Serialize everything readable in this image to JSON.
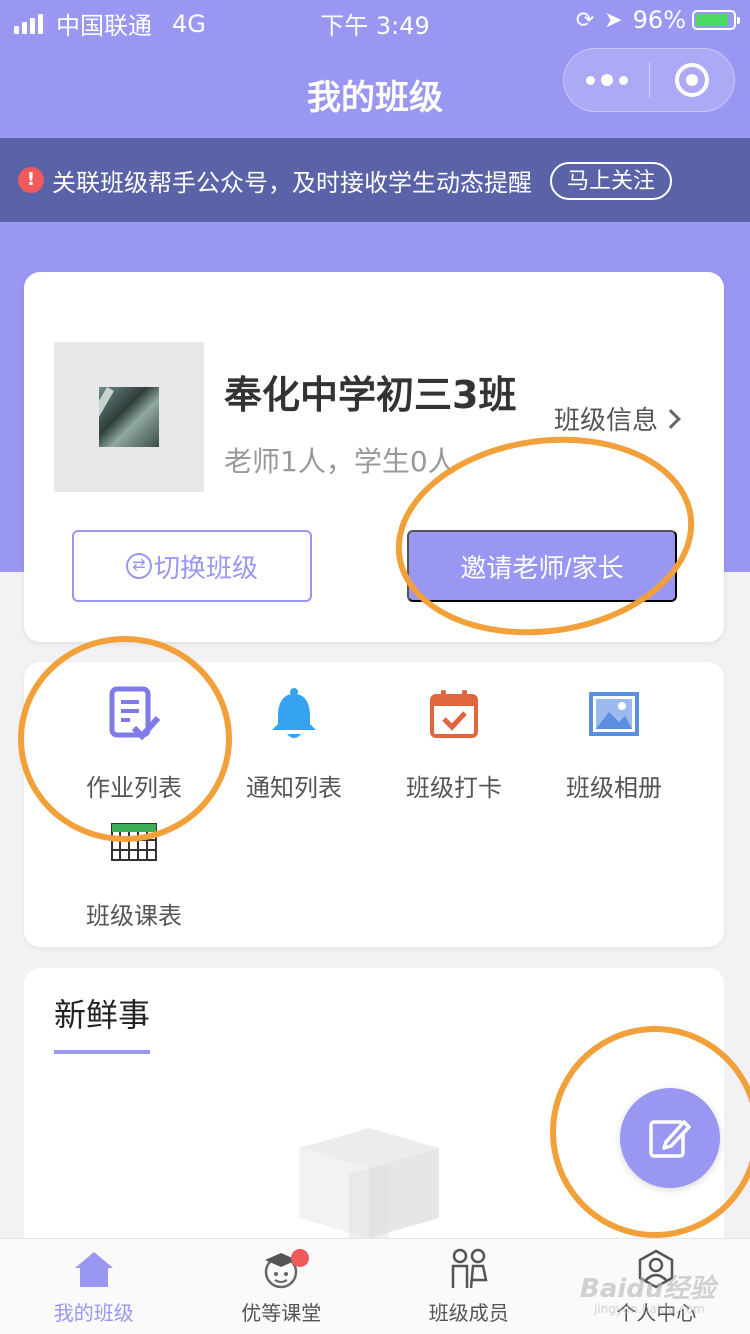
{
  "status_bar": {
    "carrier": "中国联通",
    "network": "4G",
    "time": "下午 3:49",
    "battery": "96%"
  },
  "nav": {
    "title": "我的班级"
  },
  "notice": {
    "text": "关联班级帮手公众号，及时接收学生动态提醒",
    "follow_label": "马上关注"
  },
  "class_card": {
    "name": "奉化中学初三3班",
    "stats": "老师1人，学生0人",
    "info_link": "班级信息",
    "switch_label": "切换班级",
    "invite_label": "邀请老师/家长"
  },
  "functions": [
    {
      "label": "作业列表",
      "icon": "homework-icon"
    },
    {
      "label": "通知列表",
      "icon": "bell-icon"
    },
    {
      "label": "班级打卡",
      "icon": "calendar-check-icon"
    },
    {
      "label": "班级相册",
      "icon": "photo-album-icon"
    },
    {
      "label": "班级课表",
      "icon": "timetable-icon"
    }
  ],
  "news": {
    "title": "新鲜事"
  },
  "tabs": [
    {
      "label": "我的班级",
      "icon": "house-icon",
      "active": true
    },
    {
      "label": "优等课堂",
      "icon": "graduation-icon",
      "badge": true
    },
    {
      "label": "班级成员",
      "icon": "members-icon"
    },
    {
      "label": "个人中心",
      "icon": "user-icon"
    }
  ],
  "watermark": {
    "text": "Baidu经验",
    "sub": "jingyan.baidu.com"
  },
  "colors": {
    "primary": "#9a97f3",
    "notice_bg": "#5a63a8",
    "annotation": "#f2a03a",
    "badge": "#f05a5a"
  }
}
